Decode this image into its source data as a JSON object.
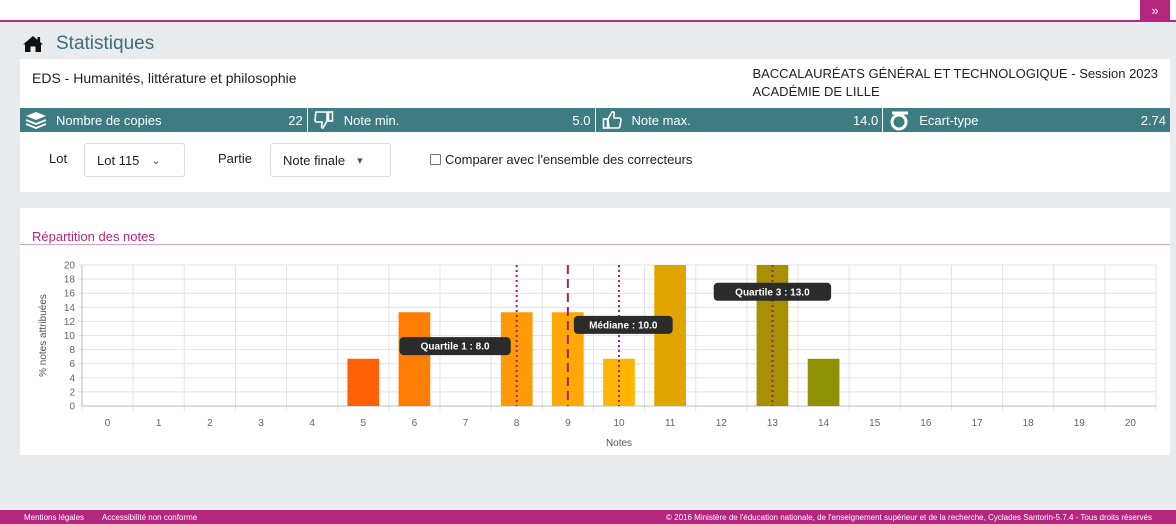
{
  "page": {
    "title": "Statistiques"
  },
  "exam": {
    "name": "EDS - Humanités, littérature et philosophie",
    "session": "BACCALAURÉATS GÉNÉRAL ET TECHNOLOGIQUE - Session 2023",
    "academy": "ACADÉMIE DE LILLE"
  },
  "stats": [
    {
      "icon": "layers-icon",
      "label": "Nombre de copies",
      "value": "22"
    },
    {
      "icon": "thumbs-down-icon",
      "label": "Note min.",
      "value": "5.0"
    },
    {
      "icon": "thumbs-up-icon",
      "label": "Note max.",
      "value": "14.0"
    },
    {
      "icon": "sigma-icon",
      "label": "Ecart-type",
      "value": "2.74"
    }
  ],
  "filters": {
    "lot_label": "Lot",
    "lot_value": "Lot 115",
    "partie_label": "Partie",
    "partie_value": "Note finale",
    "compare_label": "Comparer avec l'ensemble des correcteurs"
  },
  "chart_title": "Répartition des notes",
  "chart_data": {
    "type": "bar",
    "xlabel": "Notes",
    "ylabel": "% notes attribuées",
    "categories": [
      "0",
      "1",
      "2",
      "3",
      "4",
      "5",
      "6",
      "7",
      "8",
      "9",
      "10",
      "11",
      "12",
      "13",
      "14",
      "15",
      "16",
      "17",
      "18",
      "19",
      "20"
    ],
    "values": [
      0,
      0,
      0,
      0,
      0,
      6.7,
      13.3,
      0,
      13.3,
      13.3,
      6.7,
      20,
      0,
      20,
      6.7,
      0,
      0,
      0,
      0,
      0,
      0
    ],
    "ylim": [
      0,
      20
    ],
    "yticks": [
      0,
      2,
      4,
      6,
      8,
      10,
      12,
      14,
      16,
      18,
      20
    ],
    "grid": true,
    "bar_colors": {
      "5": "#fe6105",
      "6": "#fe7d05",
      "8": "#fe9a05",
      "9": "#fea805",
      "10": "#feb603",
      "11": "#e2a500",
      "13": "#a69003",
      "14": "#8f9205"
    },
    "annotations": [
      {
        "label": "Quartile 1 : 8.0",
        "x": 8,
        "style": "dotted",
        "color": "#a0207a"
      },
      {
        "label": "Médiane : 10.0",
        "x": 9,
        "style": "dashed",
        "color": "#a0207a"
      },
      {
        "label": "",
        "x": 10,
        "style": "dotted",
        "color": "#a0207a"
      },
      {
        "label": "Quartile 3 : 13.0",
        "x": 13,
        "style": "dotted",
        "color": "#a0207a"
      }
    ]
  },
  "footer": {
    "legal": "Mentions légales",
    "accessibility": "Accessibilité non conforme",
    "copyright": "© 2016 Ministère de l'éducation nationale, de l'enseignement supérieur et de la recherche, Cyclades Santorin-5.7.4 - Tous droits réservés"
  }
}
